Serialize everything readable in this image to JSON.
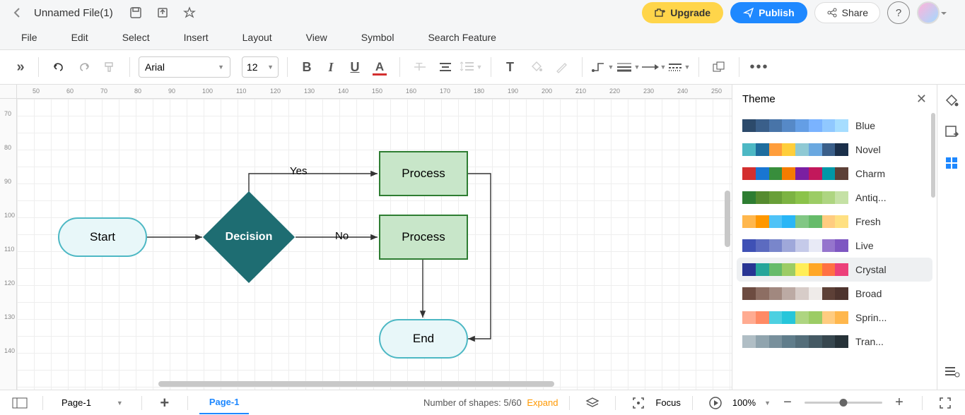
{
  "header": {
    "filename": "Unnamed File(1)",
    "upgrade_label": "Upgrade",
    "publish_label": "Publish",
    "share_label": "Share"
  },
  "menu": {
    "file": "File",
    "edit": "Edit",
    "select": "Select",
    "insert": "Insert",
    "layout": "Layout",
    "view": "View",
    "symbol": "Symbol",
    "search": "Search Feature"
  },
  "toolbar": {
    "font_family": "Arial",
    "font_size": "12"
  },
  "ruler_h": [
    "50",
    "60",
    "70",
    "80",
    "90",
    "100",
    "110",
    "120",
    "130",
    "140",
    "150",
    "160",
    "170",
    "180",
    "190",
    "200",
    "210",
    "220",
    "230",
    "240",
    "250"
  ],
  "ruler_v": [
    "70",
    "80",
    "90",
    "100",
    "110",
    "120",
    "130",
    "140"
  ],
  "flowchart": {
    "start": "Start",
    "decision": "Decision",
    "process1": "Process",
    "process2": "Process",
    "end": "End",
    "yes": "Yes",
    "no": "No"
  },
  "theme": {
    "title": "Theme",
    "items": [
      {
        "name": "Blue",
        "colors": [
          "#2c4a6b",
          "#3a5f8a",
          "#4874a8",
          "#5689c7",
          "#649ee5",
          "#7ab3ff",
          "#90c8ff",
          "#a6ddff"
        ]
      },
      {
        "name": "Novel",
        "colors": [
          "#4db8c4",
          "#1e6d9e",
          "#ff9d3b",
          "#ffce3b",
          "#8fc9d4",
          "#6aa8e0",
          "#3a5f8a",
          "#1a2f4a"
        ]
      },
      {
        "name": "Charm",
        "colors": [
          "#d32f2f",
          "#1976d2",
          "#388e3c",
          "#f57c00",
          "#7b1fa2",
          "#c2185b",
          "#0097a7",
          "#5d4037"
        ]
      },
      {
        "name": "Antiq...",
        "colors": [
          "#2e7d32",
          "#558b2f",
          "#689f38",
          "#7cb342",
          "#8bc34a",
          "#9ccc65",
          "#aed581",
          "#c5e1a5"
        ]
      },
      {
        "name": "Fresh",
        "colors": [
          "#ffb74d",
          "#ff9800",
          "#4fc3f7",
          "#29b6f6",
          "#81c784",
          "#66bb6a",
          "#ffcc80",
          "#ffe082"
        ]
      },
      {
        "name": "Live",
        "colors": [
          "#3f51b5",
          "#5c6bc0",
          "#7986cb",
          "#9fa8da",
          "#c5cae9",
          "#e8eaf6",
          "#9575cd",
          "#7e57c2"
        ]
      },
      {
        "name": "Crystal",
        "colors": [
          "#283593",
          "#26a69a",
          "#66bb6a",
          "#9ccc65",
          "#ffee58",
          "#ffa726",
          "#ff7043",
          "#ec407a"
        ]
      },
      {
        "name": "Broad",
        "colors": [
          "#6d4c41",
          "#8d6e63",
          "#a1887f",
          "#bcaaa4",
          "#d7ccc8",
          "#efebe9",
          "#5d4037",
          "#4e342e"
        ]
      },
      {
        "name": "Sprin...",
        "colors": [
          "#ffab91",
          "#ff8a65",
          "#4dd0e1",
          "#26c6da",
          "#aed581",
          "#9ccc65",
          "#ffcc80",
          "#ffb74d"
        ]
      },
      {
        "name": "Tran...",
        "colors": [
          "#b0bec5",
          "#90a4ae",
          "#78909c",
          "#607d8b",
          "#546e7a",
          "#455a64",
          "#37474f",
          "#263238"
        ]
      }
    ],
    "selected_index": 6
  },
  "bottom": {
    "page_dropdown": "Page-1",
    "page_tab": "Page-1",
    "shapes_label": "Number of shapes: 5/60",
    "expand": "Expand",
    "focus": "Focus",
    "zoom": "100%"
  }
}
